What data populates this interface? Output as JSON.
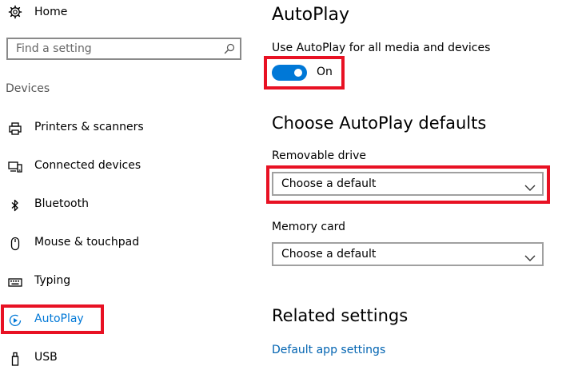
{
  "sidebar": {
    "home_label": "Home",
    "search_placeholder": "Find a setting",
    "section_label": "Devices",
    "items": [
      {
        "label": "Printers & scanners",
        "icon": "printer-icon"
      },
      {
        "label": "Connected devices",
        "icon": "connected-devices-icon"
      },
      {
        "label": "Bluetooth",
        "icon": "bluetooth-icon"
      },
      {
        "label": "Mouse & touchpad",
        "icon": "mouse-icon"
      },
      {
        "label": "Typing",
        "icon": "keyboard-icon"
      },
      {
        "label": "AutoPlay",
        "icon": "autoplay-icon",
        "selected": true
      },
      {
        "label": "USB",
        "icon": "usb-icon"
      }
    ]
  },
  "main": {
    "title": "AutoPlay",
    "use_autoplay_label": "Use AutoPlay for all media and devices",
    "toggle_state": "On",
    "defaults_heading": "Choose AutoPlay defaults",
    "removable_drive": {
      "label": "Removable drive",
      "value": "Choose a default"
    },
    "memory_card": {
      "label": "Memory card",
      "value": "Choose a default"
    },
    "related_heading": "Related settings",
    "related_link": "Default app settings"
  },
  "colors": {
    "accent": "#0078d7",
    "highlight_box": "#e81123",
    "link": "#0063b1"
  }
}
